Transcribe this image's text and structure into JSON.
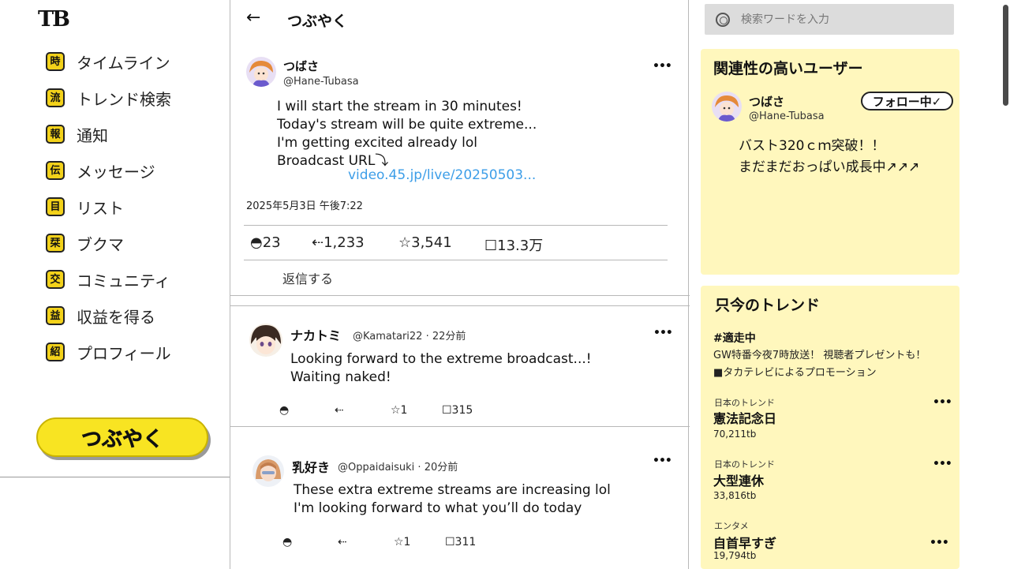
{
  "logo": "TB",
  "sidebar": {
    "items": [
      {
        "icon": "時",
        "label": "タイムライン"
      },
      {
        "icon": "流",
        "label": "トレンド検索"
      },
      {
        "icon": "報",
        "label": "通知"
      },
      {
        "icon": "伝",
        "label": "メッセージ"
      },
      {
        "icon": "目",
        "label": "リスト"
      },
      {
        "icon": "栞",
        "label": "ブクマ"
      },
      {
        "icon": "交",
        "label": "コミュニティ"
      },
      {
        "icon": "益",
        "label": "収益を得る"
      },
      {
        "icon": "紹",
        "label": "プロフィール"
      }
    ],
    "post_button": "つぶやく"
  },
  "main": {
    "back": "←",
    "title": "つぶやく",
    "post": {
      "name": "つばさ",
      "handle": "@Hane-Tubasa",
      "text": "I will start the stream in 30 minutes!\nToday's stream will be quite extreme...\nI'm getting excited already lol\nBroadcast URL⤵",
      "link": "video.45.jp/live/20250503...",
      "timestamp": "2025年5月3日 午後7:22",
      "stats": {
        "replies": "◓23",
        "reposts": "⇠1,233",
        "likes": "☆3,541",
        "views": "☐13.3万"
      },
      "reply_prompt": "返信する"
    },
    "replies": [
      {
        "name": "ナカトミ",
        "handle": "@Kamatari22 · 22分前",
        "text": "Looking forward to the extreme broadcast...!\nWaiting naked!",
        "stats": {
          "reply": "◓",
          "repost": "⇠",
          "like": "☆1",
          "views": "☐315"
        }
      },
      {
        "name": "乳好き",
        "handle": "@Oppaidaisuki · 20分前",
        "text": "These extra extreme streams are increasing lol\nI'm looking forward to what you’ll do today",
        "stats": {
          "reply": "◓",
          "repost": "⇠",
          "like": "☆1",
          "views": "☐311"
        }
      }
    ],
    "more": "•••"
  },
  "search": {
    "placeholder": "検索ワードを入力"
  },
  "related": {
    "title": "関連性の高いユーザー",
    "name": "つばさ",
    "handle": "@Hane-Tubasa",
    "follow": "フォロー中✓",
    "bio": "バスト320ｃｍ突破！！\nまだまだおっぱい成長中↗↗↗"
  },
  "trends": {
    "title": "只今のトレンド",
    "promo": {
      "tag": "#適走中",
      "desc": "GW特番今夜7時放送！ 視聴者プレゼントも！",
      "by": "■タカテレビによるプロモーション"
    },
    "items": [
      {
        "category": "日本のトレンド",
        "name": "憲法記念日",
        "count": "70,211tb"
      },
      {
        "category": "日本のトレンド",
        "name": "大型連休",
        "count": "33,816tb"
      },
      {
        "category": "エンタメ",
        "name": "自首早すぎ",
        "count": "19,794tb"
      }
    ]
  },
  "colors": {
    "accent_yellow": "#f8e422",
    "panel_bg": "#fff7bd",
    "link_blue": "#3d9ee8"
  }
}
